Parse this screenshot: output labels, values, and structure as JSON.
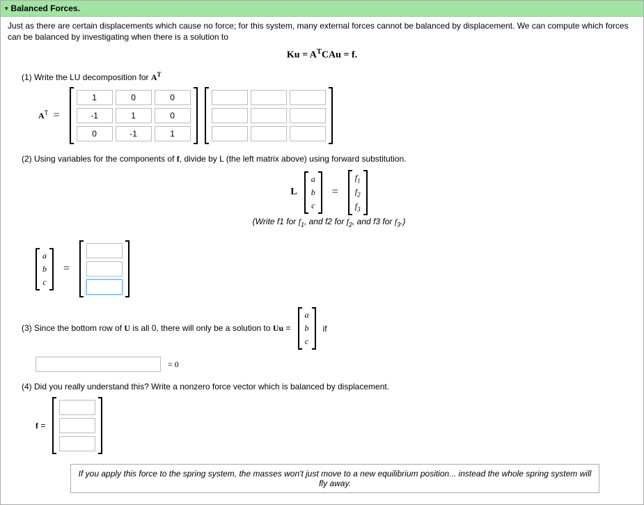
{
  "header": {
    "title": "Balanced Forces."
  },
  "intro": "Just as there are certain displacements which cause no force; for this system, many external forces cannot be balanced by displacement. We can compute which forces can be balanced by investigating when there is a solution to",
  "eq_center": "Ku = AᵀCAu = f.",
  "q1": {
    "prompt_prefix": "(1) Write the LU decomposition for ",
    "label": "Aᵀ",
    "lhs": "Aᵀ =",
    "L": [
      [
        "1",
        "0",
        "0"
      ],
      [
        "-1",
        "1",
        "0"
      ],
      [
        "0",
        "-1",
        "1"
      ]
    ]
  },
  "q2": {
    "prompt": "(2) Using variables for the components of f, divide by L (the left matrix above) using forward substitution.",
    "eq_L": "L",
    "abc": [
      "a",
      "b",
      "c"
    ],
    "rhs": [
      "f₁",
      "f₂",
      "f₃"
    ],
    "hint": "(Write f1 for f₁, and f2 for f₂, and f3 for f₃.)"
  },
  "q3": {
    "prompt_prefix": "(3) Since the bottom row of U is all 0, there will only be a solution to ",
    "uu": "Uu =",
    "if_text": "if",
    "equals_zero": "= 0"
  },
  "q4": {
    "prompt": "(4) Did you really understand this? Write a nonzero force vector which is balanced by displacement.",
    "flabel": "f ="
  },
  "note": "If you apply this force to the spring system, the masses won't just move to a new equilibrium position... instead the whole spring system will fly away."
}
